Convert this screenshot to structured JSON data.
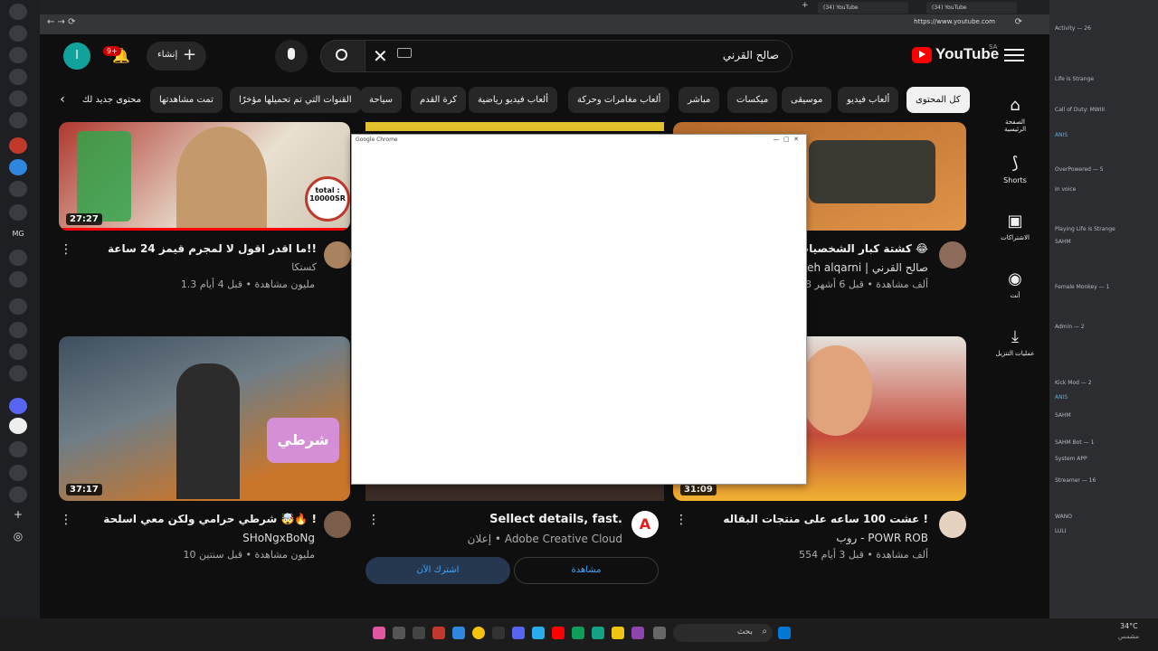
{
  "browser": {
    "tabs": [
      "(34) YouTube",
      "(34) YouTube"
    ],
    "url": "https://www.youtube.com"
  },
  "youtube": {
    "logo": "YouTube",
    "region": "SA",
    "search_value": "صالح القرني",
    "create_label": "إنشاء",
    "notif_count": "9+",
    "avatar_letter": "I",
    "chips": [
      "كل المحتوى",
      "ألعاب فيديو",
      "موسيقى",
      "ميكسات",
      "مباشر",
      "ألعاب مغامرات وحركة",
      "ألعاب فيديو رياضية",
      "كرة القدم",
      "سياحة",
      "القنوات التي تم تحميلها مؤخرًا",
      "تمت مشاهدتها",
      "محتوى جديد لك"
    ],
    "nav": [
      "الصفحة الرئيسية",
      "Shorts",
      "الاشتراكات",
      "أنت",
      "عمليات التنزيل"
    ],
    "videos": [
      {
        "title": "ما اقدر اقول لا لمجرم قيمز 24 ساعة!!",
        "channel": "كستكا",
        "meta": "1.3 مليون مشاهدة • قبل 4 أيام",
        "duration": "27:27"
      },
      {
        "title": "😂 كشتة كبار الشخصيات 😂",
        "channel": "saleh alqarni | صالح القرني",
        "meta": "28 ألف مشاهدة • قبل 6 أشهر",
        "duration": ""
      },
      {
        "title": "شرطي حرامي ولكن معي اسلحة 🤯🔥 !",
        "channel": "SHoNgxBoNg",
        "meta": "10 مليون مشاهدة • قبل سنتين",
        "duration": "37:17"
      },
      {
        "title": "عشت 100 ساعه على منتجات البقاله !",
        "channel": "روب - POWR ROB",
        "meta": "554 ألف مشاهدة • قبل 3 أيام",
        "duration": "31:09"
      }
    ],
    "ad": {
      "title": "Sellect details, fast.",
      "sponsor": "إعلان • Adobe Creative Cloud",
      "btn_watch": "مشاهدة",
      "btn_sub": "اشترك الآن"
    },
    "thumb_text": "total : 10000SR"
  },
  "popup": {
    "title": "Google Chrome"
  },
  "discord": {
    "lines": [
      "Activity — 26",
      "Life is Strange",
      "Call of Duty: MWIII",
      "ANIS",
      "OverPowered — 5",
      "In voice",
      "Playing Life is Strange",
      "SAHM",
      "Female Monkey — 1",
      "Admin — 2",
      "Kick Mod — 2",
      "ANIS",
      "SAHM Bot — 1",
      "System APP",
      "Streamer — 16",
      "WANO",
      "LULI",
      "SAHM"
    ]
  },
  "taskbar": {
    "search": "بحث",
    "temp": "34°C",
    "time": "مشمس"
  }
}
